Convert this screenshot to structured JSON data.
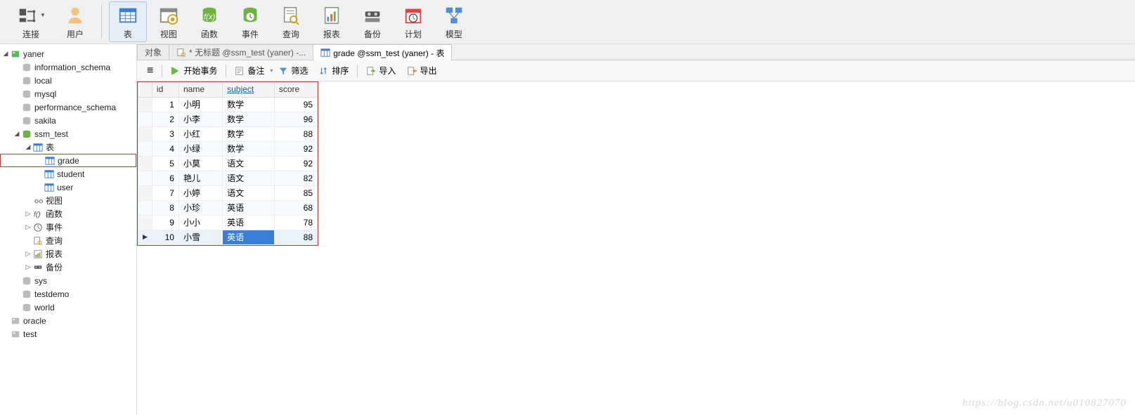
{
  "toolbar": [
    {
      "name": "connection",
      "label": "连接",
      "dropdown": true
    },
    {
      "name": "user",
      "label": "用户"
    },
    {
      "sep": true
    },
    {
      "name": "table",
      "label": "表",
      "active": true
    },
    {
      "name": "view",
      "label": "视图"
    },
    {
      "name": "function",
      "label": "函数"
    },
    {
      "name": "event",
      "label": "事件"
    },
    {
      "name": "query",
      "label": "查询"
    },
    {
      "name": "report",
      "label": "报表"
    },
    {
      "name": "backup",
      "label": "备份"
    },
    {
      "name": "schedule",
      "label": "计划"
    },
    {
      "name": "model",
      "label": "模型"
    }
  ],
  "tree": [
    {
      "d": 0,
      "twist": "◢",
      "icon": "server-green",
      "label": "yaner"
    },
    {
      "d": 1,
      "twist": "",
      "icon": "db",
      "label": "information_schema"
    },
    {
      "d": 1,
      "twist": "",
      "icon": "db",
      "label": "local"
    },
    {
      "d": 1,
      "twist": "",
      "icon": "db",
      "label": "mysql"
    },
    {
      "d": 1,
      "twist": "",
      "icon": "db",
      "label": "performance_schema"
    },
    {
      "d": 1,
      "twist": "",
      "icon": "db",
      "label": "sakila"
    },
    {
      "d": 1,
      "twist": "◢",
      "icon": "db-open",
      "label": "ssm_test"
    },
    {
      "d": 2,
      "twist": "◢",
      "icon": "table",
      "label": "表"
    },
    {
      "d": 3,
      "twist": "",
      "icon": "table",
      "label": "grade",
      "selected": true
    },
    {
      "d": 3,
      "twist": "",
      "icon": "table",
      "label": "student"
    },
    {
      "d": 3,
      "twist": "",
      "icon": "table",
      "label": "user"
    },
    {
      "d": 2,
      "twist": "",
      "icon": "view",
      "label": "视图"
    },
    {
      "d": 2,
      "twist": "▷",
      "icon": "fx",
      "label": "函数"
    },
    {
      "d": 2,
      "twist": "▷",
      "icon": "event",
      "label": "事件"
    },
    {
      "d": 2,
      "twist": "",
      "icon": "query",
      "label": "查询"
    },
    {
      "d": 2,
      "twist": "▷",
      "icon": "report",
      "label": "报表"
    },
    {
      "d": 2,
      "twist": "▷",
      "icon": "backup",
      "label": "备份"
    },
    {
      "d": 1,
      "twist": "",
      "icon": "db",
      "label": "sys"
    },
    {
      "d": 1,
      "twist": "",
      "icon": "db",
      "label": "testdemo"
    },
    {
      "d": 1,
      "twist": "",
      "icon": "db",
      "label": "world"
    },
    {
      "d": 0,
      "twist": "",
      "icon": "server",
      "label": "oracle"
    },
    {
      "d": 0,
      "twist": "",
      "icon": "server",
      "label": "test"
    }
  ],
  "tabs": [
    {
      "name": "objects",
      "label": "对象"
    },
    {
      "name": "untitled-query",
      "label": "* 无标题 @ssm_test (yaner) -...",
      "icon": "query"
    },
    {
      "name": "grade-table",
      "label": "grade @ssm_test (yaner) - 表",
      "icon": "table",
      "active": true
    }
  ],
  "actions": {
    "menu": "≡",
    "begin_tx": "开始事务",
    "memo": "备注",
    "filter": "筛选",
    "sort": "排序",
    "import": "导入",
    "export": "导出"
  },
  "grid": {
    "columns": [
      "id",
      "name",
      "subject",
      "score"
    ],
    "sorted_col": "subject",
    "rows": [
      {
        "id": 1,
        "name": "小明",
        "subject": "数学",
        "score": 95
      },
      {
        "id": 2,
        "name": "小李",
        "subject": "数学",
        "score": 96
      },
      {
        "id": 3,
        "name": "小红",
        "subject": "数学",
        "score": 88
      },
      {
        "id": 4,
        "name": "小绿",
        "subject": "数学",
        "score": 92
      },
      {
        "id": 5,
        "name": "小莫",
        "subject": "语文",
        "score": 92
      },
      {
        "id": 6,
        "name": "艳儿",
        "subject": "语文",
        "score": 82
      },
      {
        "id": 7,
        "name": "小婷",
        "subject": "语文",
        "score": 85
      },
      {
        "id": 8,
        "name": "小珍",
        "subject": "英语",
        "score": 68
      },
      {
        "id": 9,
        "name": "小小",
        "subject": "英语",
        "score": 78
      },
      {
        "id": 10,
        "name": "小雪",
        "subject": "英语",
        "score": 88,
        "current": true,
        "sel_col": "subject"
      }
    ]
  },
  "watermark": "https://blog.csdn.net/u010827070"
}
